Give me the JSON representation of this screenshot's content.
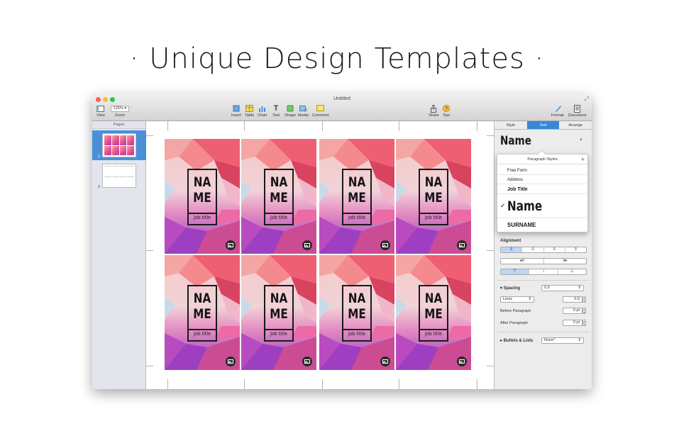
{
  "headline": "· Unique Design Templates ·",
  "window": {
    "title": "Untitled",
    "toolbar": {
      "view": "View",
      "zoom_label": "Zoom",
      "zoom_value": "125%",
      "insert": "Insert",
      "table": "Table",
      "chart": "Chart",
      "text": "Text",
      "shape": "Shape",
      "media": "Media",
      "comment": "Comment",
      "share": "Share",
      "tips": "Tips",
      "format": "Format",
      "document": "Document"
    },
    "pages_pane": {
      "header": "Pages",
      "pages": [
        {
          "number": "1",
          "selected": true
        },
        {
          "number": "2",
          "selected": false
        }
      ]
    },
    "cards": [
      {
        "name": "NA\nME",
        "job_title": "Job title"
      },
      {
        "name": "NA\nME",
        "job_title": "Job title"
      },
      {
        "name": "NA\nME",
        "job_title": "Job title"
      },
      {
        "name": "NA\nME",
        "job_title": "Job title"
      },
      {
        "name": "NA\nME",
        "job_title": "Job title"
      },
      {
        "name": "NA\nME",
        "job_title": "Job title"
      },
      {
        "name": "NA\nME",
        "job_title": "Job title"
      },
      {
        "name": "NA\nME",
        "job_title": "Job title"
      }
    ],
    "inspector": {
      "tabs": [
        "Style",
        "Text",
        "Arrange"
      ],
      "active_tab": "Text",
      "paragraph_style": "Name",
      "popover": {
        "header": "Paragraph Styles",
        "items": [
          "Free Form",
          "Address",
          "Job Title",
          "Name",
          "SURNAME"
        ],
        "checked": "Name"
      },
      "alignment_label": "Alignment",
      "spacing_label": "Spacing",
      "spacing_value": "0,9",
      "lines_label": "Lines",
      "lines_value": "0,9",
      "before_paragraph_label": "Before Paragraph",
      "before_paragraph_value": "0 pt",
      "after_paragraph_label": "After Paragraph",
      "after_paragraph_value": "0 pt",
      "bullets_label": "Bullets & Lists",
      "bullets_value": "None*"
    }
  },
  "colors": {
    "accent": "#3a86d8",
    "card_gradient": [
      "#f7c6c4",
      "#e84a5f",
      "#c03fa0",
      "#7a3bbf"
    ]
  }
}
